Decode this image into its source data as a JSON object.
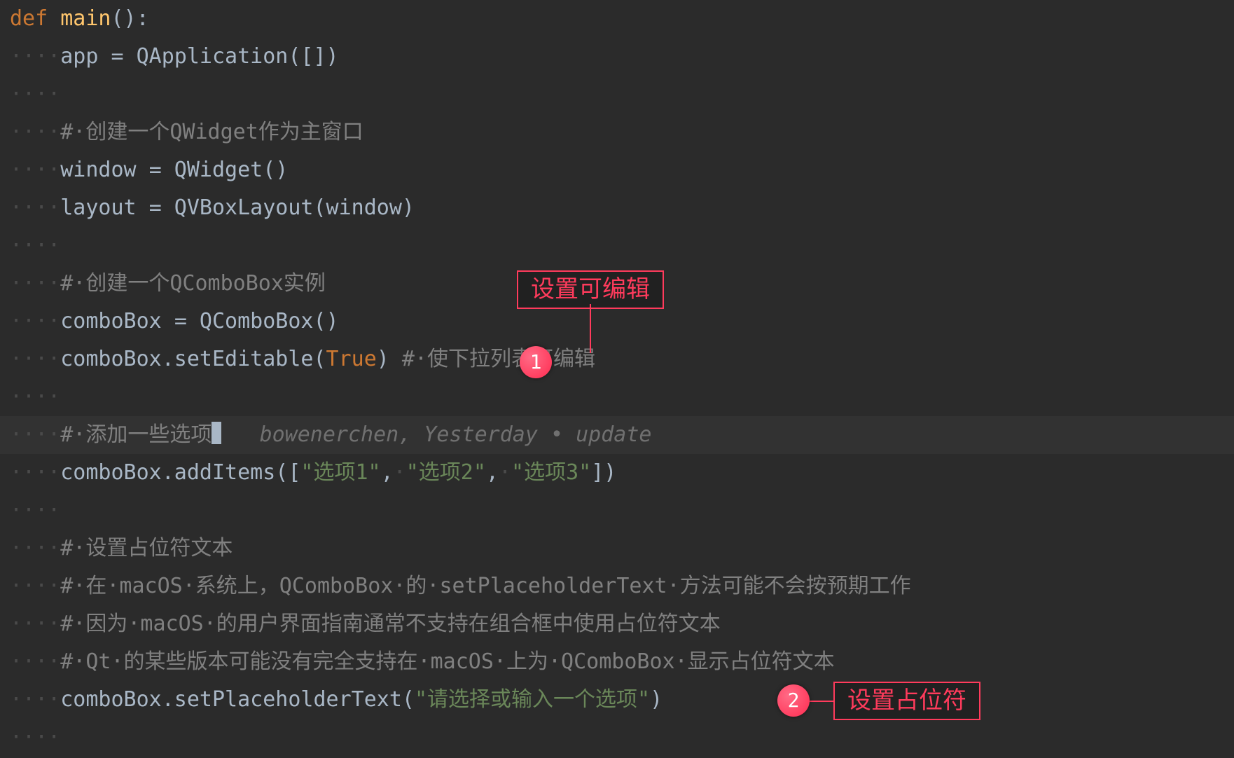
{
  "annotations": {
    "a1": {
      "badge": "1",
      "label": "设置可编辑"
    },
    "a2": {
      "badge": "2",
      "label": "设置占位符"
    }
  },
  "blame": {
    "info": "bowenerchen, Yesterday • update"
  },
  "code": {
    "l1_def": "def",
    "l1_sp": " ",
    "l1_main": "main",
    "l1_par": "():",
    "ws4": "····",
    "l2_app": "app ",
    "l2_eq": "=",
    "l2_qapp": " QApplication([])",
    "l4_c": "#·创建一个QWidget作为主窗口",
    "l5_win": "window ",
    "l5_eq": "=",
    "l5_rest": " QWidget()",
    "l6_lay": "layout ",
    "l6_eq": "=",
    "l6_rest": " QVBoxLayout(window)",
    "l8_c": "#·创建一个QComboBox实例",
    "l9_cb": "comboBox ",
    "l9_eq": "=",
    "l9_rest": " QComboBox()",
    "l10_call": "comboBox.setEditable(",
    "l10_true": "True",
    "l10_close": ") ",
    "l10_c": "#·使下拉列表可编辑",
    "l12_c": "#·添加一些选项",
    "l13_pre": "comboBox.addItems([",
    "l13_s1": "\"选项1\"",
    "l13_com1": ",",
    "l13_sp1": "·",
    "l13_s2": "\"选项2\"",
    "l13_com2": ",",
    "l13_sp2": "·",
    "l13_s3": "\"选项3\"",
    "l13_end": "])",
    "l15_c": "#·设置占位符文本",
    "l16_c": "#·在·macOS·系统上，QComboBox·的·setPlaceholderText·方法可能不会按预期工作",
    "l17_c": "#·因为·macOS·的用户界面指南通常不支持在组合框中使用占位符文本",
    "l18_c": "#·Qt·的某些版本可能没有完全支持在·macOS·上为·QComboBox·显示占位符文本",
    "l19_pre": "comboBox.setPlaceholderText(",
    "l19_s": "\"请选择或输入一个选项\"",
    "l19_end": ")"
  }
}
